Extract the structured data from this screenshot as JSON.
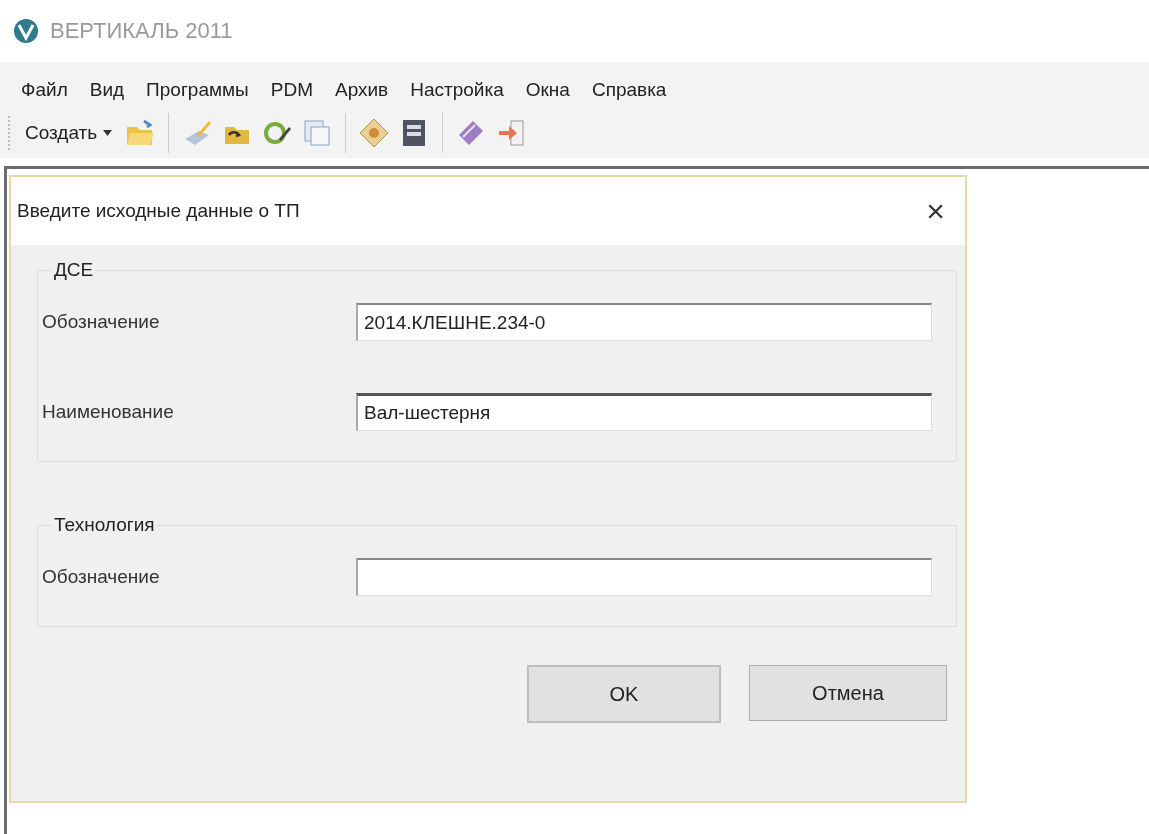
{
  "window": {
    "title": "ВЕРТИКАЛЬ 2011"
  },
  "menu": [
    "Файл",
    "Вид",
    "Программы",
    "PDM",
    "Архив",
    "Настройка",
    "Окна",
    "Справка"
  ],
  "toolbar": {
    "create_button": "Создать"
  },
  "dialog": {
    "title": "Введите исходные данные о ТП",
    "close": "×",
    "groups": [
      {
        "title": "ДСЕ",
        "fields": [
          {
            "label": "Обозначение",
            "value": "2014.КЛЕШНЕ.234-0",
            "focused": false
          },
          {
            "label": "Наименование",
            "value": "Вал-шестерня",
            "focused": true
          }
        ]
      },
      {
        "title": "Технология",
        "fields": [
          {
            "label": "Обозначение",
            "focused": false
          }
        ]
      }
    ],
    "buttons": [
      {
        "label": "OK",
        "default": true
      },
      {
        "label": "Отмена",
        "default": false
      }
    ]
  }
}
